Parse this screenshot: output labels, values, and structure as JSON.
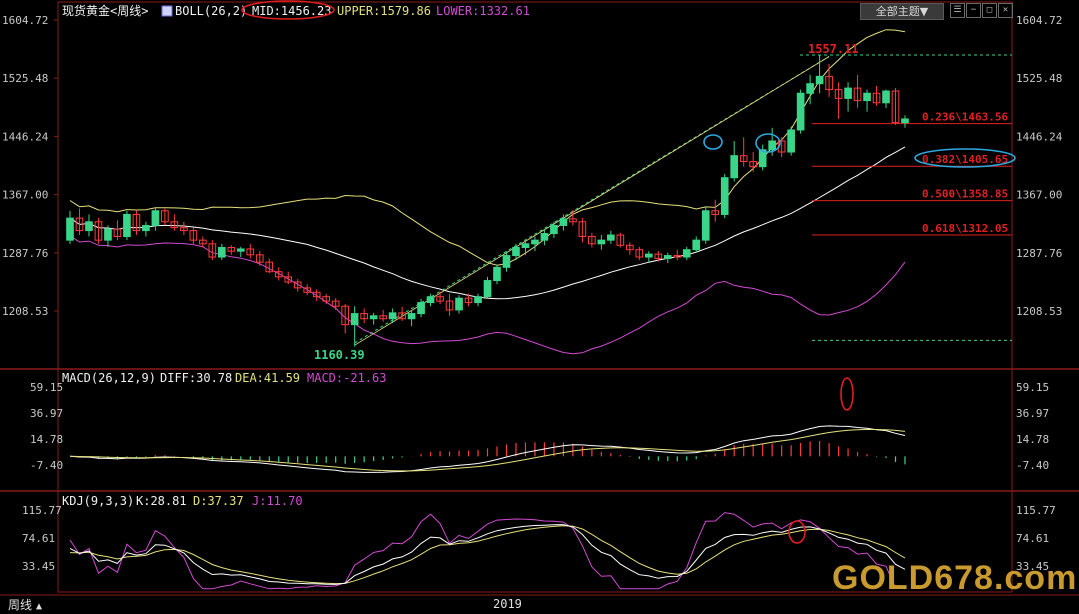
{
  "header": {
    "symbol": "现货黄金<周线>",
    "indicator_name": "BOLL(26,2)",
    "mid_label": "MID:1456.23",
    "upper_label": "UPPER:1579.86",
    "lower_label": "LOWER:1332.61",
    "theme_button": "全部主题▼"
  },
  "macd_header": {
    "name": "MACD(26,12,9)",
    "diff_label": "DIFF:30.78",
    "dea_label": "DEA:41.59",
    "macd_label": "MACD:-21.63"
  },
  "kdj_header": {
    "name": "KDJ(9,3,3)",
    "k_label": "K:28.81",
    "d_label": "D:37.37",
    "j_label": "J:11.70"
  },
  "footer": {
    "period_label": "周线",
    "year_label": "2019"
  },
  "watermark": "GOLD678.com",
  "colors": {
    "up": "#39d68a",
    "down": "#ff3b3b",
    "mid": "#ffffff",
    "upper": "#e6e07a",
    "lower": "#d24bd2",
    "diff": "#ffffff",
    "dea": "#e6e07a",
    "j": "#d24bd2",
    "fib": "#e02020",
    "grid": "#8b1a1a",
    "axis_text": "#c9c9c9",
    "annot_ellipse": "#2ea8e0",
    "annot_red": "#e01e1e"
  },
  "chart_data": [
    {
      "type": "candlestick",
      "title": "现货黄金<周线>",
      "y_ticks": [
        1604.72,
        1525.48,
        1446.24,
        1367.0,
        1287.76,
        1208.53
      ],
      "ylim": [
        1160,
        1620
      ],
      "x_tick_labels": [
        "2019"
      ],
      "candles": [
        {
          "o": 1305,
          "h": 1345,
          "l": 1300,
          "c": 1335
        },
        {
          "o": 1335,
          "h": 1348,
          "l": 1312,
          "c": 1318
        },
        {
          "o": 1318,
          "h": 1340,
          "l": 1310,
          "c": 1330
        },
        {
          "o": 1330,
          "h": 1335,
          "l": 1300,
          "c": 1305
        },
        {
          "o": 1305,
          "h": 1325,
          "l": 1296,
          "c": 1320
        },
        {
          "o": 1320,
          "h": 1332,
          "l": 1305,
          "c": 1310
        },
        {
          "o": 1310,
          "h": 1345,
          "l": 1305,
          "c": 1340
        },
        {
          "o": 1340,
          "h": 1345,
          "l": 1312,
          "c": 1318
        },
        {
          "o": 1318,
          "h": 1330,
          "l": 1310,
          "c": 1325
        },
        {
          "o": 1325,
          "h": 1350,
          "l": 1318,
          "c": 1345
        },
        {
          "o": 1345,
          "h": 1348,
          "l": 1325,
          "c": 1330
        },
        {
          "o": 1330,
          "h": 1340,
          "l": 1318,
          "c": 1322
        },
        {
          "o": 1322,
          "h": 1330,
          "l": 1312,
          "c": 1318
        },
        {
          "o": 1318,
          "h": 1322,
          "l": 1300,
          "c": 1305
        },
        {
          "o": 1305,
          "h": 1310,
          "l": 1295,
          "c": 1300
        },
        {
          "o": 1300,
          "h": 1305,
          "l": 1278,
          "c": 1282
        },
        {
          "o": 1282,
          "h": 1300,
          "l": 1278,
          "c": 1295
        },
        {
          "o": 1295,
          "h": 1298,
          "l": 1285,
          "c": 1290
        },
        {
          "o": 1290,
          "h": 1296,
          "l": 1282,
          "c": 1293
        },
        {
          "o": 1293,
          "h": 1300,
          "l": 1280,
          "c": 1285
        },
        {
          "o": 1285,
          "h": 1290,
          "l": 1270,
          "c": 1275
        },
        {
          "o": 1275,
          "h": 1280,
          "l": 1260,
          "c": 1262
        },
        {
          "o": 1262,
          "h": 1268,
          "l": 1250,
          "c": 1255
        },
        {
          "o": 1255,
          "h": 1262,
          "l": 1245,
          "c": 1248
        },
        {
          "o": 1248,
          "h": 1252,
          "l": 1235,
          "c": 1240
        },
        {
          "o": 1240,
          "h": 1245,
          "l": 1230,
          "c": 1234
        },
        {
          "o": 1234,
          "h": 1238,
          "l": 1222,
          "c": 1228
        },
        {
          "o": 1228,
          "h": 1232,
          "l": 1218,
          "c": 1222
        },
        {
          "o": 1222,
          "h": 1226,
          "l": 1210,
          "c": 1215
        },
        {
          "o": 1215,
          "h": 1218,
          "l": 1178,
          "c": 1190
        },
        {
          "o": 1190,
          "h": 1215,
          "l": 1160,
          "c": 1205
        },
        {
          "o": 1205,
          "h": 1212,
          "l": 1192,
          "c": 1198
        },
        {
          "o": 1198,
          "h": 1206,
          "l": 1190,
          "c": 1202
        },
        {
          "o": 1202,
          "h": 1210,
          "l": 1194,
          "c": 1198
        },
        {
          "o": 1198,
          "h": 1212,
          "l": 1192,
          "c": 1206
        },
        {
          "o": 1206,
          "h": 1214,
          "l": 1195,
          "c": 1198
        },
        {
          "o": 1198,
          "h": 1210,
          "l": 1188,
          "c": 1205
        },
        {
          "o": 1205,
          "h": 1225,
          "l": 1200,
          "c": 1220
        },
        {
          "o": 1220,
          "h": 1232,
          "l": 1215,
          "c": 1228
        },
        {
          "o": 1228,
          "h": 1235,
          "l": 1218,
          "c": 1222
        },
        {
          "o": 1222,
          "h": 1232,
          "l": 1202,
          "c": 1210
        },
        {
          "o": 1210,
          "h": 1230,
          "l": 1205,
          "c": 1226
        },
        {
          "o": 1226,
          "h": 1232,
          "l": 1215,
          "c": 1220
        },
        {
          "o": 1220,
          "h": 1232,
          "l": 1215,
          "c": 1228
        },
        {
          "o": 1228,
          "h": 1255,
          "l": 1225,
          "c": 1250
        },
        {
          "o": 1250,
          "h": 1272,
          "l": 1245,
          "c": 1268
        },
        {
          "o": 1268,
          "h": 1290,
          "l": 1262,
          "c": 1284
        },
        {
          "o": 1284,
          "h": 1300,
          "l": 1278,
          "c": 1295
        },
        {
          "o": 1295,
          "h": 1305,
          "l": 1285,
          "c": 1300
        },
        {
          "o": 1300,
          "h": 1310,
          "l": 1290,
          "c": 1305
        },
        {
          "o": 1305,
          "h": 1320,
          "l": 1298,
          "c": 1314
        },
        {
          "o": 1314,
          "h": 1330,
          "l": 1308,
          "c": 1325
        },
        {
          "o": 1325,
          "h": 1340,
          "l": 1318,
          "c": 1334
        },
        {
          "o": 1334,
          "h": 1346,
          "l": 1325,
          "c": 1330
        },
        {
          "o": 1330,
          "h": 1335,
          "l": 1302,
          "c": 1310
        },
        {
          "o": 1310,
          "h": 1315,
          "l": 1295,
          "c": 1300
        },
        {
          "o": 1300,
          "h": 1312,
          "l": 1292,
          "c": 1305
        },
        {
          "o": 1305,
          "h": 1318,
          "l": 1300,
          "c": 1312
        },
        {
          "o": 1312,
          "h": 1315,
          "l": 1295,
          "c": 1298
        },
        {
          "o": 1298,
          "h": 1302,
          "l": 1285,
          "c": 1292
        },
        {
          "o": 1292,
          "h": 1296,
          "l": 1278,
          "c": 1282
        },
        {
          "o": 1282,
          "h": 1290,
          "l": 1275,
          "c": 1286
        },
        {
          "o": 1286,
          "h": 1290,
          "l": 1276,
          "c": 1280
        },
        {
          "o": 1280,
          "h": 1288,
          "l": 1274,
          "c": 1284
        },
        {
          "o": 1284,
          "h": 1292,
          "l": 1278,
          "c": 1282
        },
        {
          "o": 1282,
          "h": 1296,
          "l": 1278,
          "c": 1292
        },
        {
          "o": 1292,
          "h": 1310,
          "l": 1288,
          "c": 1305
        },
        {
          "o": 1305,
          "h": 1350,
          "l": 1300,
          "c": 1345
        },
        {
          "o": 1345,
          "h": 1360,
          "l": 1330,
          "c": 1340
        },
        {
          "o": 1340,
          "h": 1395,
          "l": 1335,
          "c": 1390
        },
        {
          "o": 1390,
          "h": 1440,
          "l": 1385,
          "c": 1420
        },
        {
          "o": 1420,
          "h": 1445,
          "l": 1405,
          "c": 1412
        },
        {
          "o": 1412,
          "h": 1425,
          "l": 1398,
          "c": 1405
        },
        {
          "o": 1405,
          "h": 1435,
          "l": 1400,
          "c": 1428
        },
        {
          "o": 1428,
          "h": 1458,
          "l": 1420,
          "c": 1440
        },
        {
          "o": 1440,
          "h": 1445,
          "l": 1418,
          "c": 1425
        },
        {
          "o": 1425,
          "h": 1460,
          "l": 1420,
          "c": 1455
        },
        {
          "o": 1455,
          "h": 1510,
          "l": 1450,
          "c": 1505
        },
        {
          "o": 1505,
          "h": 1530,
          "l": 1490,
          "c": 1518
        },
        {
          "o": 1518,
          "h": 1557,
          "l": 1505,
          "c": 1528
        },
        {
          "o": 1528,
          "h": 1545,
          "l": 1500,
          "c": 1510
        },
        {
          "o": 1510,
          "h": 1520,
          "l": 1470,
          "c": 1498
        },
        {
          "o": 1498,
          "h": 1520,
          "l": 1480,
          "c": 1512
        },
        {
          "o": 1512,
          "h": 1530,
          "l": 1485,
          "c": 1495
        },
        {
          "o": 1495,
          "h": 1510,
          "l": 1480,
          "c": 1505
        },
        {
          "o": 1505,
          "h": 1515,
          "l": 1488,
          "c": 1492
        },
        {
          "o": 1492,
          "h": 1510,
          "l": 1485,
          "c": 1508
        },
        {
          "o": 1508,
          "h": 1512,
          "l": 1462,
          "c": 1465
        },
        {
          "o": 1465,
          "h": 1475,
          "l": 1458,
          "c": 1470
        }
      ],
      "bollinger": {
        "mid_label": "MID:1456.23",
        "upper_label": "UPPER:1579.86",
        "lower_label": "LOWER:1332.61"
      },
      "annotations": {
        "high_label": "1557.11",
        "low_label": "1160.39",
        "fib_levels": [
          {
            "label": "0.236\\1463.56",
            "value": 1463.56
          },
          {
            "label": "0.382\\1405.65",
            "value": 1405.65
          },
          {
            "label": "0.500\\1358.85",
            "value": 1358.85
          },
          {
            "label": "0.618\\1312.05",
            "value": 1312.05
          }
        ]
      }
    },
    {
      "type": "line",
      "title": "MACD(26,12,9)",
      "y_ticks": [
        59.15,
        36.97,
        14.78,
        -7.4
      ],
      "series": [
        {
          "name": "DIFF",
          "label": "DIFF:30.78"
        },
        {
          "name": "DEA",
          "label": "DEA:41.59"
        },
        {
          "name": "MACD",
          "label": "MACD:-21.63"
        }
      ]
    },
    {
      "type": "line",
      "title": "KDJ(9,3,3)",
      "y_ticks": [
        115.77,
        74.61,
        33.45
      ],
      "series": [
        {
          "name": "K",
          "label": "K:28.81"
        },
        {
          "name": "D",
          "label": "D:37.37"
        },
        {
          "name": "J",
          "label": "J:11.70"
        }
      ]
    }
  ]
}
